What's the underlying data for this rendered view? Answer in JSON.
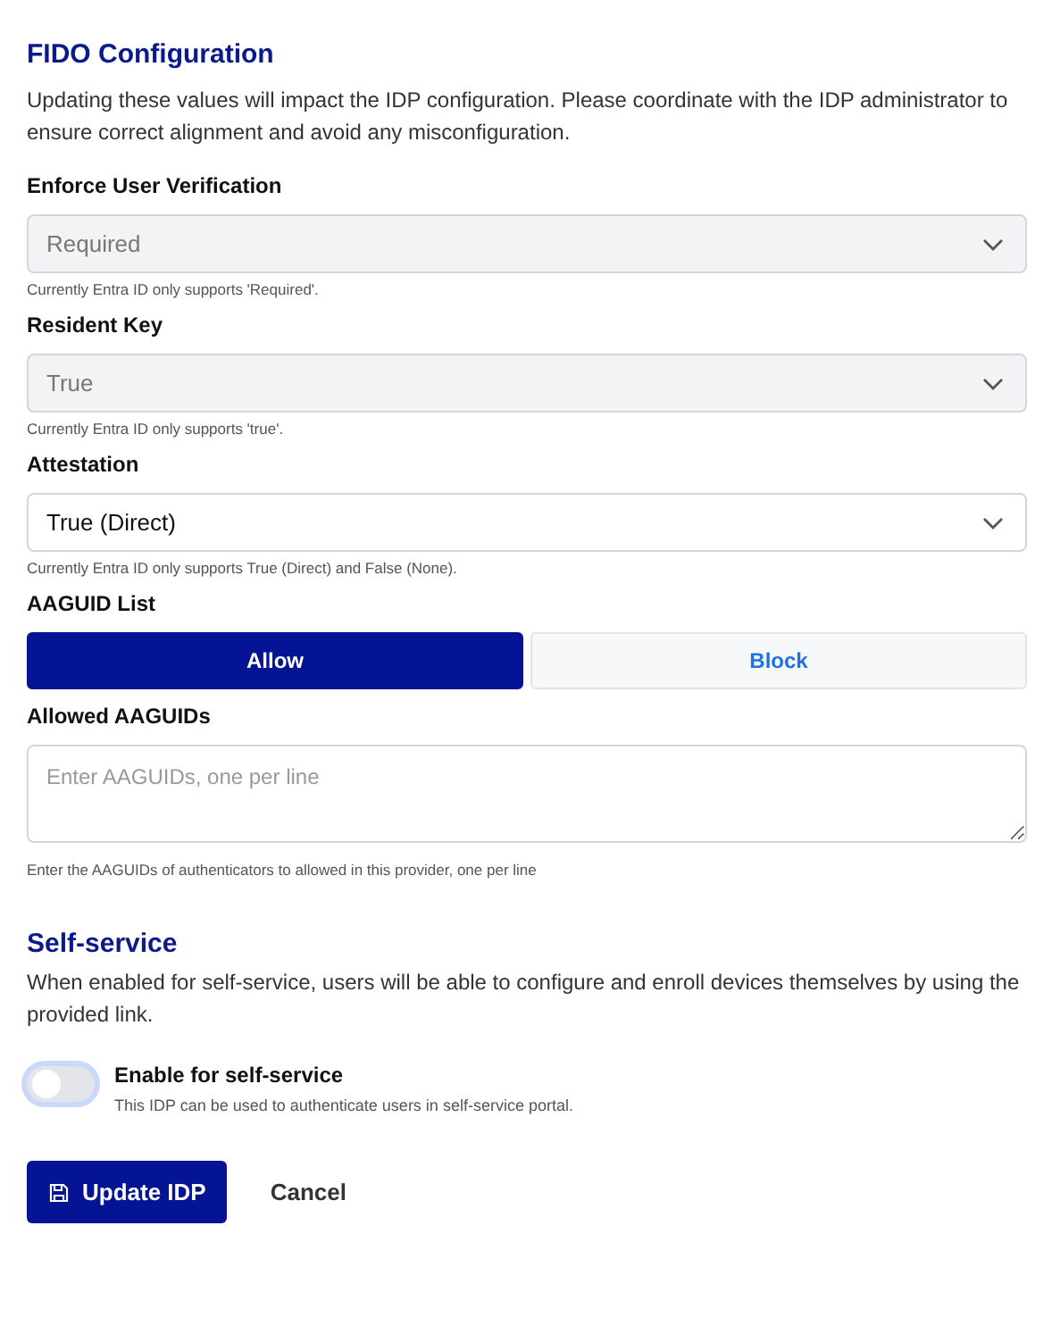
{
  "fido": {
    "title": "FIDO Configuration",
    "description": "Updating these values will impact the IDP configuration. Please coordinate with the IDP administrator to ensure correct alignment and avoid any misconfiguration.",
    "fields": [
      {
        "kind": "select",
        "label": "Enforce User Verification",
        "value": "Required",
        "disabled": true,
        "hint": "Currently Entra ID only supports 'Required'."
      },
      {
        "kind": "select",
        "label": "Resident Key",
        "value": "True",
        "disabled": true,
        "hint": "Currently Entra ID only supports 'true'."
      },
      {
        "kind": "select",
        "label": "Attestation",
        "value": "True (Direct)",
        "disabled": false,
        "hint": "Currently Entra ID only supports True (Direct) and False (None)."
      },
      {
        "kind": "segmented",
        "label": "AAGUID List",
        "options": [
          {
            "label": "Allow",
            "selected": true
          },
          {
            "label": "Block",
            "selected": false
          }
        ]
      },
      {
        "kind": "textarea",
        "label": "Allowed AAGUIDs",
        "placeholder": "Enter AAGUIDs, one per line",
        "hint": "Enter the AAGUIDs of authenticators to allowed in this provider, one per line"
      }
    ]
  },
  "self_service": {
    "title": "Self-service",
    "description": "When enabled for self-service, users will be able to configure and enroll devices themselves by using the provided link.",
    "toggle": {
      "label": "Enable for self-service",
      "description": "This IDP can be used to authenticate users in self-service portal.",
      "on": false
    }
  },
  "buttons": {
    "primary": "Update IDP",
    "secondary": "Cancel"
  }
}
